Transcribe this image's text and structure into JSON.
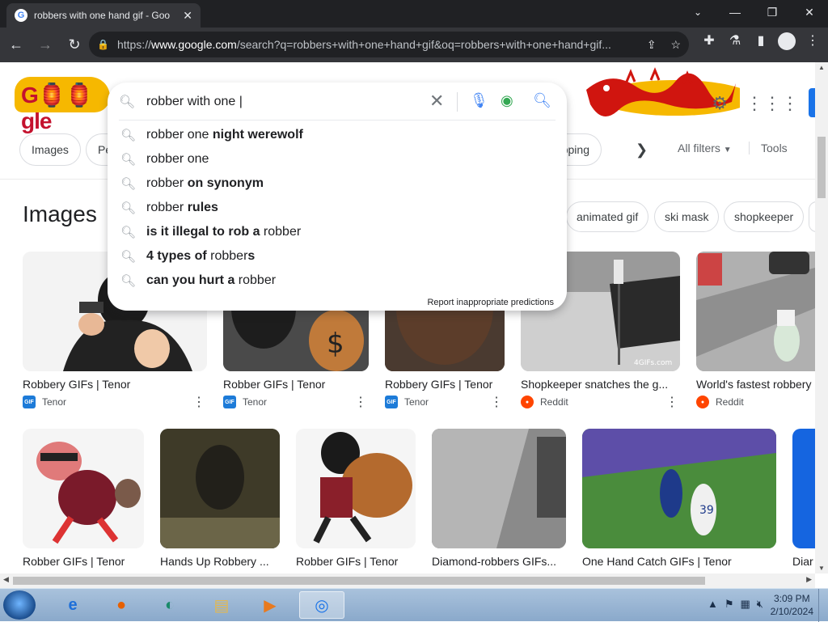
{
  "browser": {
    "tab_title": "robbers with one hand gif - Goo",
    "tab_favicon": "G",
    "url_prefix": "https://",
    "url_domain": "www.google.com",
    "url_rest": "/search?q=robbers+with+one+hand+gif&oq=robbers+with+one+hand+gif..."
  },
  "logo_text": "G🏮🏮gle",
  "search": {
    "query": "robber with one |",
    "suggestions": [
      {
        "normal": "robber one ",
        "bold": "night werewolf",
        "order": "nb"
      },
      {
        "normal": "robber one",
        "bold": "",
        "order": "nb"
      },
      {
        "normal": "robber ",
        "bold": "on synonym",
        "order": "nb"
      },
      {
        "normal": "robber ",
        "bold": "rules",
        "order": "nb"
      },
      {
        "bold": "is it illegal to rob a ",
        "normal": "robber",
        "order": "bn"
      },
      {
        "bold": "4 types of ",
        "normal": "robber",
        "bold2": "s",
        "order": "bnb"
      },
      {
        "bold": "can you hurt a ",
        "normal": "robber",
        "order": "bn"
      }
    ],
    "report_text": "Report inappropriate predictions"
  },
  "chips": [
    "Images",
    "Pe",
    "pping",
    "All filters",
    "Tools"
  ],
  "images_heading": "Images",
  "related_chips": [
    "animated gif",
    "ski mask",
    "shopkeeper"
  ],
  "row1": [
    {
      "caption": "Robbery GIFs | Tenor",
      "source": "Tenor",
      "src_type": "tenor"
    },
    {
      "caption": "Robber GIFs | Tenor",
      "source": "Tenor",
      "src_type": "tenor"
    },
    {
      "caption": "Robbery GIFs | Tenor",
      "source": "Tenor",
      "src_type": "tenor"
    },
    {
      "caption": "Shopkeeper snatches the g...",
      "source": "Reddit",
      "src_type": "reddit"
    },
    {
      "caption": "World's fastest robbery",
      "source": "Reddit",
      "src_type": "reddit"
    }
  ],
  "row2": [
    {
      "caption": "Robber GIFs | Tenor"
    },
    {
      "caption": "Hands Up Robbery ..."
    },
    {
      "caption": "Robber GIFs | Tenor"
    },
    {
      "caption": "Diamond-robbers GIFs..."
    },
    {
      "caption": "One Hand Catch GIFs | Tenor"
    },
    {
      "caption": "Diar"
    }
  ],
  "watermark": "4GIFs.com",
  "taskbar": {
    "time": "3:09 PM",
    "date": "2/10/2024"
  }
}
